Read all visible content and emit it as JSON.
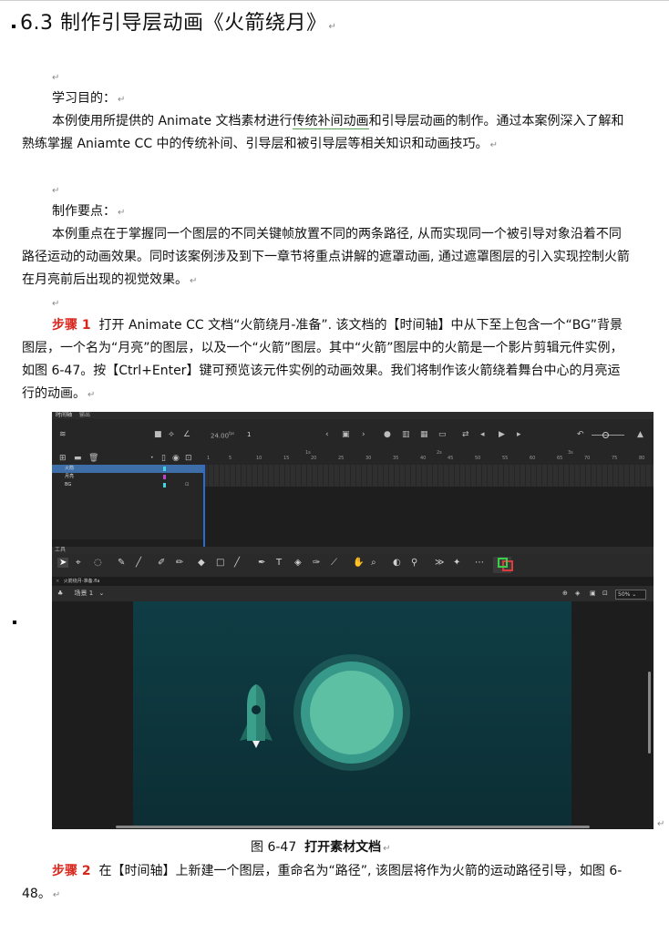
{
  "title": "6.3  制作引导层动画《火箭绕月》",
  "objective_heading": "学习目的：",
  "objective_body": {
    "a": "本例使用所提供的  Animate  文档素材进行",
    "u": "传统补间动画",
    "b": "和引导层动画的制作。通过本案例深入了解和熟练掌握 Aniamte CC 中的传统补间、引导层和被引导层等相关知识和动画技巧。"
  },
  "points_heading": "制作要点：",
  "points_body": "本例重点在于掌握同一个图层的不同关键帧放置不同的两条路径, 从而实现同一个被引导对象沿着不同路径运动的动画效果。同时该案例涉及到下一章节将重点讲解的遮罩动画, 通过遮罩图层的引入实现控制火箭在月亮前后出现的视觉效果。",
  "step1_label": "步骤 1",
  "step1_text": "打开 Animate CC 文档“火箭绕月-准备”. 该文档的【时间轴】中从下至上包含一个“BG”背景图层，一个名为“月亮”的图层，以及一个“火箭”图层。其中“火箭”图层中的火箭是一个影片剪辑元件实例，如图 6-47。按【Ctrl+Enter】键可预览该元件实例的动画效果。我们将制作该火箭绕着舞台中心的月亮运行的动画。",
  "figure_label": "图 6-47",
  "figure_caption": "打开素材文档",
  "step2_label": "步骤 2",
  "step2_text": "在【时间轴】上新建一个图层，重命名为“路径”, 该图层将作为火箭的运动路径引导，如图 6-48。",
  "screenshot": {
    "timeline_tab": "时间轴",
    "output_tab": "输出",
    "fps": "24.00",
    "fps_unit": "fps",
    "frame": "1",
    "ruler": [
      "1",
      "5",
      "10",
      "15",
      "20",
      "25",
      "30",
      "35",
      "40",
      "45",
      "50",
      "55",
      "60",
      "65",
      "70",
      "75",
      "80"
    ],
    "seconds": [
      "1s",
      "2s",
      "3s"
    ],
    "layers": [
      "火箭",
      "月亮",
      "BG"
    ],
    "tools_title": "工具",
    "doc_tab": "火箭绕月-准备.fla",
    "scene": "场景 1",
    "zoom": "50%",
    "colors": {
      "stage_top": "#0f3d45",
      "moon_inner": "#5ec0a3",
      "moon_ring": "#2a7c72",
      "rocket": "#3aa08c"
    }
  }
}
